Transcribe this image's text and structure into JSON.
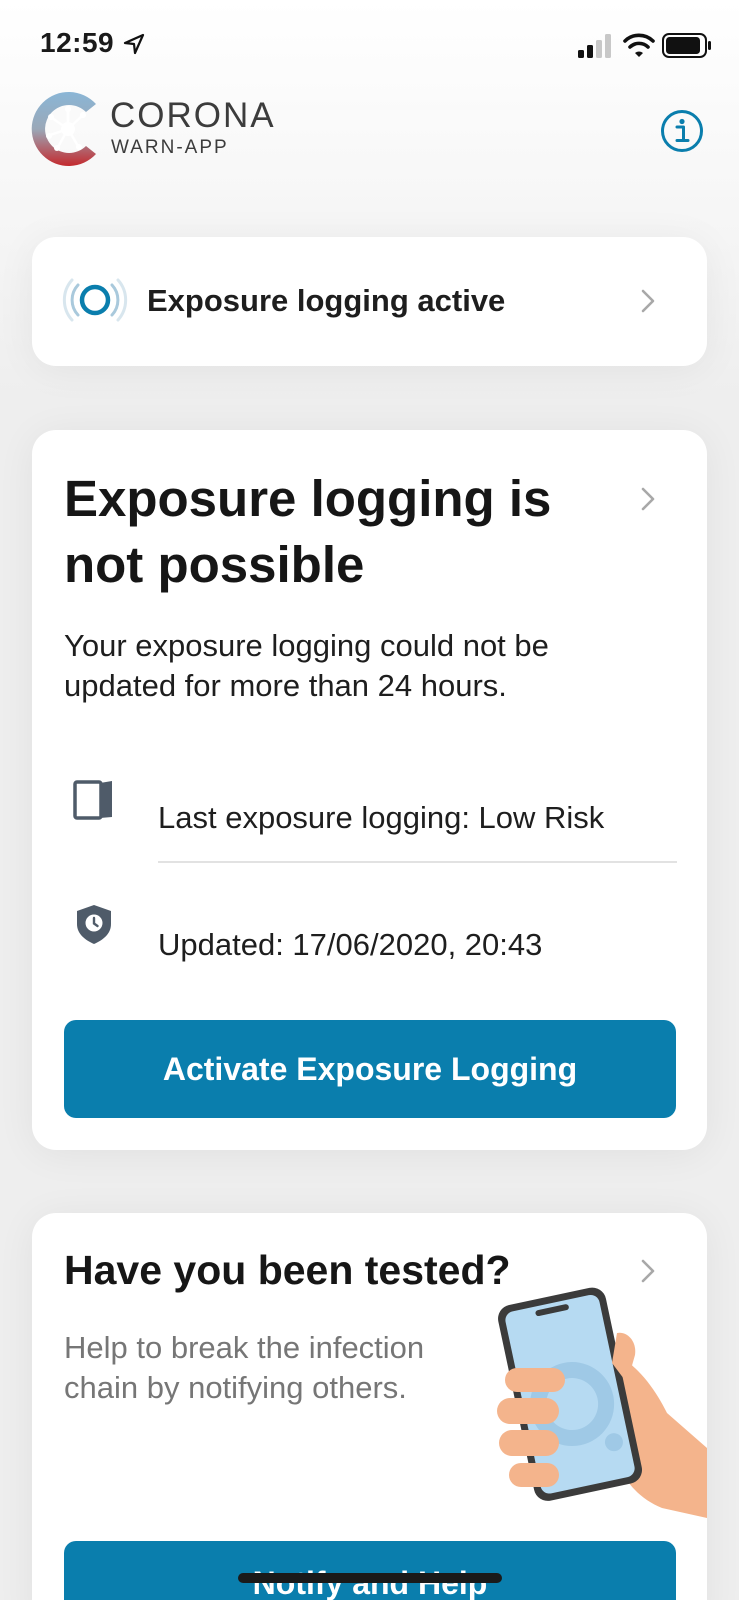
{
  "status_bar": {
    "time": "12:59"
  },
  "header": {
    "logo_title": "CORONA",
    "logo_subtitle": "WARN-APP"
  },
  "colors": {
    "accent": "#0a7ead",
    "logo_blue": "#6a9ec0",
    "logo_red": "#c42a2e"
  },
  "status_card": {
    "label": "Exposure logging active",
    "icon": "radar-icon"
  },
  "risk_card": {
    "title": "Exposure logging is not possible",
    "description": "Your exposure logging could not be updated for more than 24 hours.",
    "last_logging": "Last exposure logging: Low Risk",
    "updated": "Updated: 17/06/2020, 20:43",
    "button_label": "Activate Exposure Logging"
  },
  "test_card": {
    "title": "Have you been tested?",
    "description": "Help to break the infection chain by notifying others.",
    "button_label": "Notify and Help"
  }
}
